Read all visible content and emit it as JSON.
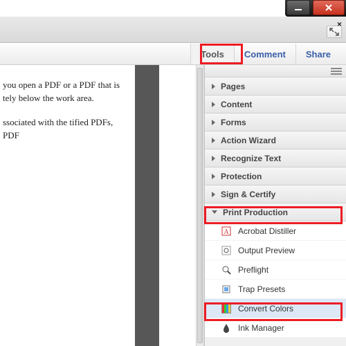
{
  "window": {
    "close_glyph": "×"
  },
  "tabs": {
    "tools": "Tools",
    "comment": "Comment",
    "share": "Share"
  },
  "document": {
    "p1": "you open a PDF or a PDF that is tely below the work area.",
    "p2": "ssociated with the tified PDFs, PDF"
  },
  "panel": {
    "sections": {
      "pages": "Pages",
      "content": "Content",
      "forms": "Forms",
      "action_wizard": "Action Wizard",
      "recognize_text": "Recognize Text",
      "protection": "Protection",
      "sign_certify": "Sign & Certify",
      "print_production": "Print Production"
    },
    "print_production_items": {
      "acrobat_distiller": "Acrobat Distiller",
      "output_preview": "Output Preview",
      "preflight": "Preflight",
      "trap_presets": "Trap Presets",
      "convert_colors": "Convert Colors",
      "ink_manager": "Ink Manager"
    }
  }
}
